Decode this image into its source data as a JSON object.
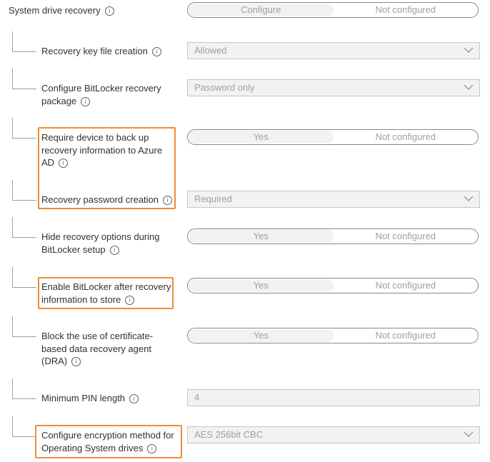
{
  "header": {
    "title": "System drive recovery",
    "toggle_on": "Configure",
    "toggle_off": "Not configured"
  },
  "settings": {
    "recovery_key_file": {
      "label": "Recovery key file creation",
      "value": "Allowed"
    },
    "recovery_package": {
      "label_line1": "Configure BitLocker recovery",
      "label_line2": "package",
      "value": "Password only"
    },
    "backup_azure_ad": {
      "label_line1": "Require device to back up",
      "label_line2": "recovery information to Azure",
      "label_line3": "AD",
      "yes": "Yes",
      "not_configured": "Not configured"
    },
    "recovery_password": {
      "label": "Recovery password creation",
      "value": "Required"
    },
    "hide_options": {
      "label_line1": "Hide recovery options during",
      "label_line2": "BitLocker setup",
      "yes": "Yes",
      "not_configured": "Not configured"
    },
    "enable_after_store": {
      "label_line1": "Enable BitLocker after recovery",
      "label_line2": "information to store",
      "yes": "Yes",
      "not_configured": "Not configured"
    },
    "block_dra": {
      "label_line1": "Block the use of certificate-",
      "label_line2": "based data recovery agent",
      "label_line3": "(DRA)",
      "yes": "Yes",
      "not_configured": "Not configured"
    },
    "min_pin": {
      "label": "Minimum PIN length",
      "value": "4"
    },
    "encryption_method": {
      "label_line1": "Configure encryption method for",
      "label_line2": "Operating System drives",
      "value": "AES 256bit CBC"
    }
  },
  "colors": {
    "highlight": "#f08a33",
    "disabled_text": "#a19f9d",
    "field_bg": "#f3f2f1"
  }
}
